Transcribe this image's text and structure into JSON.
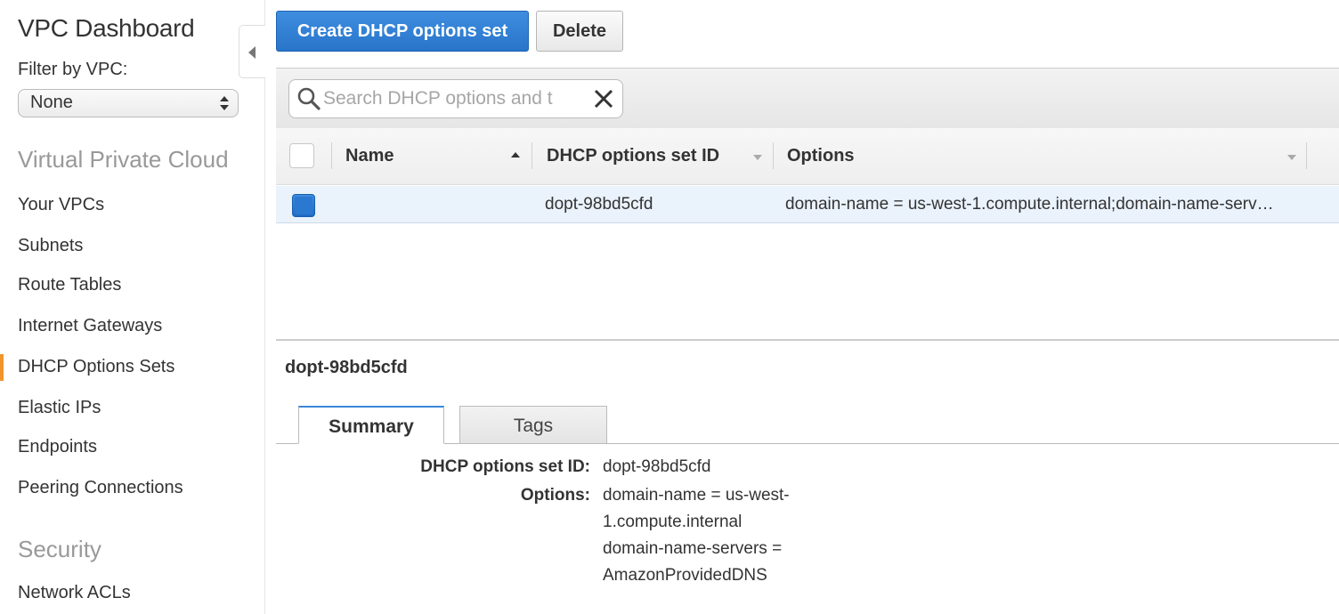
{
  "sidebar": {
    "title": "VPC Dashboard",
    "filter_label": "Filter by VPC:",
    "filter_value": "None",
    "section_vpc": "Virtual Private Cloud",
    "items": [
      {
        "label": "Your VPCs"
      },
      {
        "label": "Subnets"
      },
      {
        "label": "Route Tables"
      },
      {
        "label": "Internet Gateways"
      },
      {
        "label": "DHCP Options Sets"
      },
      {
        "label": "Elastic IPs"
      },
      {
        "label": "Endpoints"
      },
      {
        "label": "Peering Connections"
      }
    ],
    "section_security": "Security",
    "security_items": [
      {
        "label": "Network ACLs"
      }
    ],
    "active_item": "DHCP Options Sets",
    "accent_color": "#f0952b"
  },
  "toolbar": {
    "create_label": "Create DHCP options set",
    "delete_label": "Delete"
  },
  "search": {
    "placeholder": "Search DHCP options and t",
    "value": ""
  },
  "table": {
    "columns": [
      "Name",
      "DHCP options set ID",
      "Options"
    ],
    "sorted_column": "Name",
    "rows": [
      {
        "selected": true,
        "name": "",
        "id": "dopt-98bd5cfd",
        "options": "domain-name = us-west-1.compute.internal;domain-name-serv…"
      }
    ]
  },
  "detail": {
    "title": "dopt-98bd5cfd",
    "tabs": [
      {
        "label": "Summary",
        "active": true
      },
      {
        "label": "Tags",
        "active": false
      }
    ],
    "fields": {
      "id_label": "DHCP options set ID:",
      "id_value": "dopt-98bd5cfd",
      "options_label": "Options:",
      "options_lines": [
        "domain-name = us-west-",
        "1.compute.internal",
        "domain-name-servers =",
        "AmazonProvidedDNS"
      ]
    }
  }
}
